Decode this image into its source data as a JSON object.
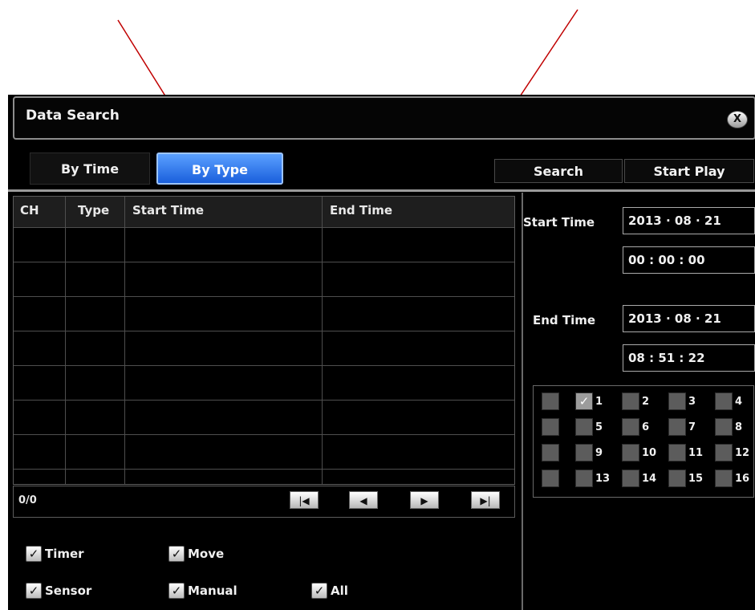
{
  "window": {
    "title": "Data Search",
    "close_label": "X"
  },
  "tabs": [
    {
      "label": "By Time",
      "active": false
    },
    {
      "label": "By Type",
      "active": true
    }
  ],
  "actions": {
    "search_label": "Search",
    "start_play_label": "Start Play"
  },
  "table": {
    "columns": [
      "CH",
      "Type",
      "Start Time",
      "End Time"
    ],
    "rows": []
  },
  "pager": {
    "count": "0/0",
    "first_glyph": "|◀",
    "prev_glyph": "◀",
    "next_glyph": "▶",
    "last_glyph": "▶|"
  },
  "type_filters": [
    {
      "label": "Timer",
      "checked": true
    },
    {
      "label": "Move",
      "checked": true
    },
    {
      "label": "Sensor",
      "checked": true
    },
    {
      "label": "Manual",
      "checked": true
    },
    {
      "label": "All",
      "checked": true
    }
  ],
  "time_range": {
    "start_label": "Start Time",
    "start_date": "2013 · 08 · 21",
    "start_time": "00 : 00 : 00",
    "end_label": "End Time",
    "end_date": "2013 · 08 · 21",
    "end_time": "08 : 51 : 22"
  },
  "channels": {
    "all_checked": false,
    "items": [
      {
        "label": "1",
        "checked": true
      },
      {
        "label": "2",
        "checked": false
      },
      {
        "label": "3",
        "checked": false
      },
      {
        "label": "4",
        "checked": false
      },
      {
        "label": "5",
        "checked": false
      },
      {
        "label": "6",
        "checked": false
      },
      {
        "label": "7",
        "checked": false
      },
      {
        "label": "8",
        "checked": false
      },
      {
        "label": "9",
        "checked": false
      },
      {
        "label": "10",
        "checked": false
      },
      {
        "label": "11",
        "checked": false
      },
      {
        "label": "12",
        "checked": false
      },
      {
        "label": "13",
        "checked": false
      },
      {
        "label": "14",
        "checked": false
      },
      {
        "label": "15",
        "checked": false
      },
      {
        "label": "16",
        "checked": false
      }
    ]
  },
  "colors": {
    "active_tab": "#2f7bf0",
    "annotation_arrow": "#c00000"
  },
  "check_glyph": "✓"
}
